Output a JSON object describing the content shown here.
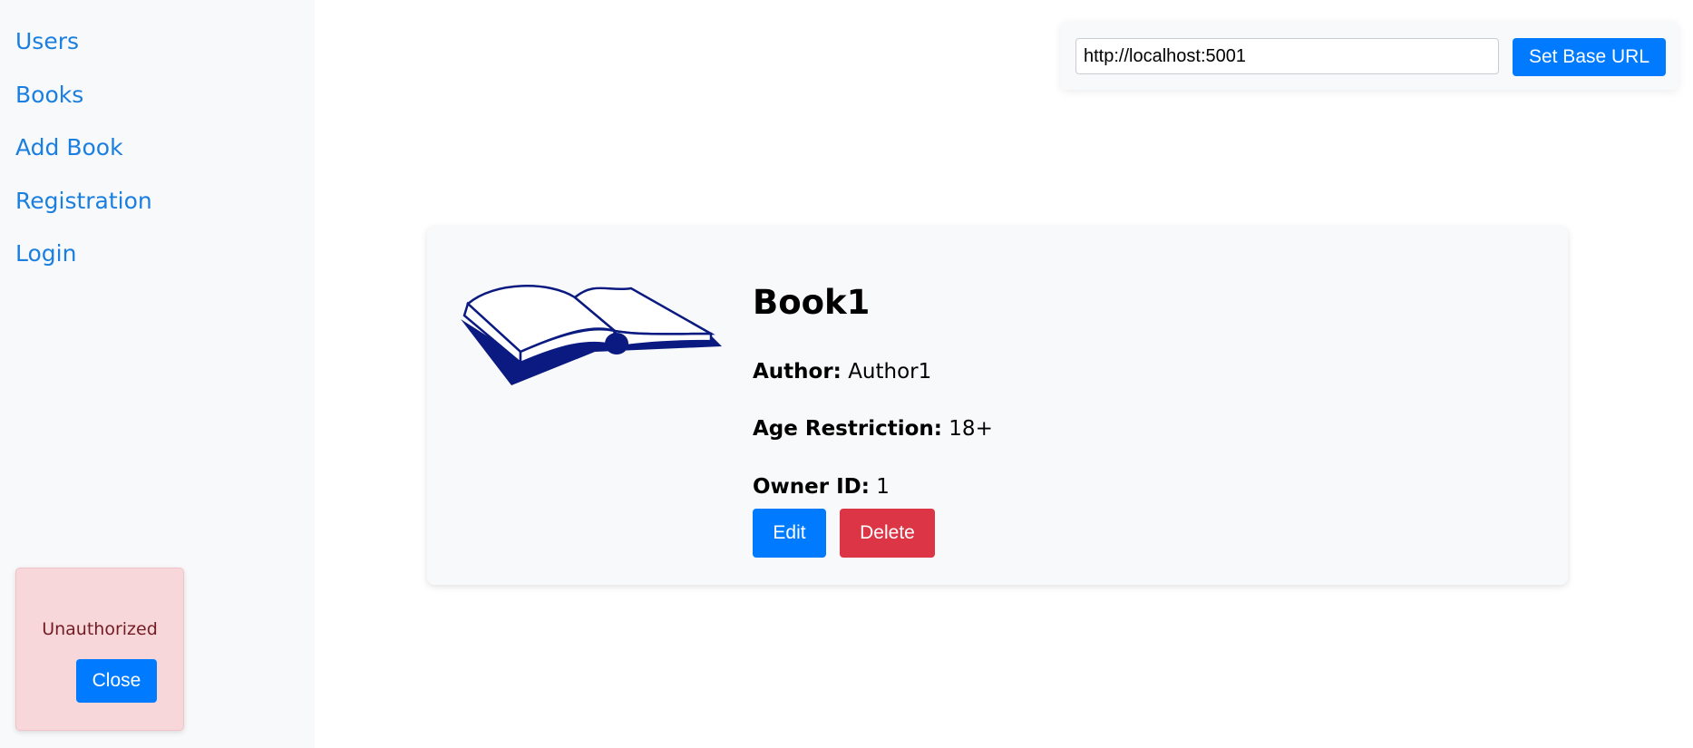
{
  "sidebar": {
    "items": [
      {
        "label": "Users"
      },
      {
        "label": "Books"
      },
      {
        "label": "Add Book"
      },
      {
        "label": "Registration"
      },
      {
        "label": "Login"
      }
    ]
  },
  "toast": {
    "message": "Unauthorized",
    "close_label": "Close"
  },
  "base_url": {
    "value": "http://localhost:5001",
    "button_label": "Set Base URL"
  },
  "book": {
    "title": "Book1",
    "author_label": "Author:",
    "author": "Author1",
    "age_label": "Age Restriction:",
    "age": "18+",
    "owner_label": "Owner ID:",
    "owner": "1",
    "edit_label": "Edit",
    "delete_label": "Delete",
    "image_icon": "open-book-icon"
  },
  "colors": {
    "primary": "#007bff",
    "danger": "#dc3545",
    "link": "#1a7fe0",
    "alert_bg": "#f8d7da",
    "alert_text": "#721c24",
    "book_ink": "#0a1a80"
  }
}
